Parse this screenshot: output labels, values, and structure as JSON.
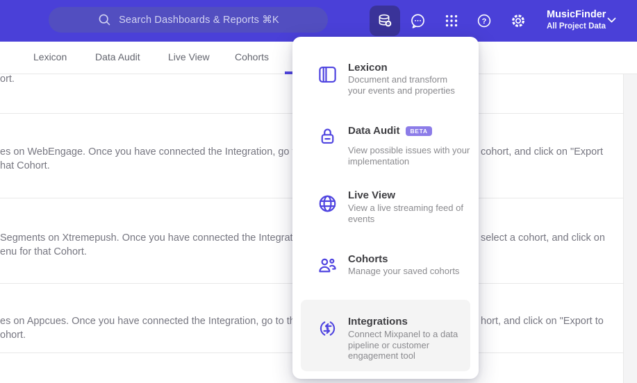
{
  "colors": {
    "topbar_bg": "#4A40D8",
    "search_bg": "#524EC0",
    "active_icon_bg": "#3A3399",
    "accent": "#4F44E0",
    "badge_bg": "#8C7CE8",
    "highlight_bg": "#F4F4F4"
  },
  "topbar": {
    "search_placeholder": "Search Dashboards & Reports ⌘K",
    "project_name": "MusicFinder",
    "project_subtitle": "All Project Data",
    "icons": [
      "data-management",
      "messages",
      "apps-grid",
      "help",
      "settings",
      "chevron-down"
    ]
  },
  "tabs": [
    {
      "label": "Lexicon"
    },
    {
      "label": "Data Audit"
    },
    {
      "label": "Live View"
    },
    {
      "label": "Cohorts"
    }
  ],
  "menu": {
    "items": [
      {
        "icon": "lexicon-book",
        "title": "Lexicon",
        "desc": "Document and transform\nyour events and properties"
      },
      {
        "icon": "data-audit-lock",
        "title": "Data Audit",
        "badge": "BETA",
        "desc": "View possible issues with your\nimplementation"
      },
      {
        "icon": "globe",
        "title": "Live View",
        "desc": "View a live streaming feed of\nevents"
      },
      {
        "icon": "people",
        "title": "Cohorts",
        "desc": "Manage your saved cohorts"
      },
      {
        "icon": "sync-arrows",
        "title": "Integrations",
        "desc": "Connect Mixpanel to a data\npipeline or customer\nengagement tool"
      }
    ]
  },
  "content": {
    "row1_fragment": "ort.",
    "rows": [
      {
        "left1": "es on WebEngage. Once you have connected the Integration, go to the",
        "left2": "hat Cohort.",
        "right1": "cohort, and click on \"Export"
      },
      {
        "left1": "Segments on Xtremepush. Once you have connected the Integration,",
        "left2": "enu for that Cohort.",
        "right1": "select a cohort, and click on"
      },
      {
        "left1": "es on Appcues. Once you have connected the Integration, go to the M",
        "left2": "ohort.",
        "right1": "hort, and click on \"Export to"
      }
    ]
  }
}
